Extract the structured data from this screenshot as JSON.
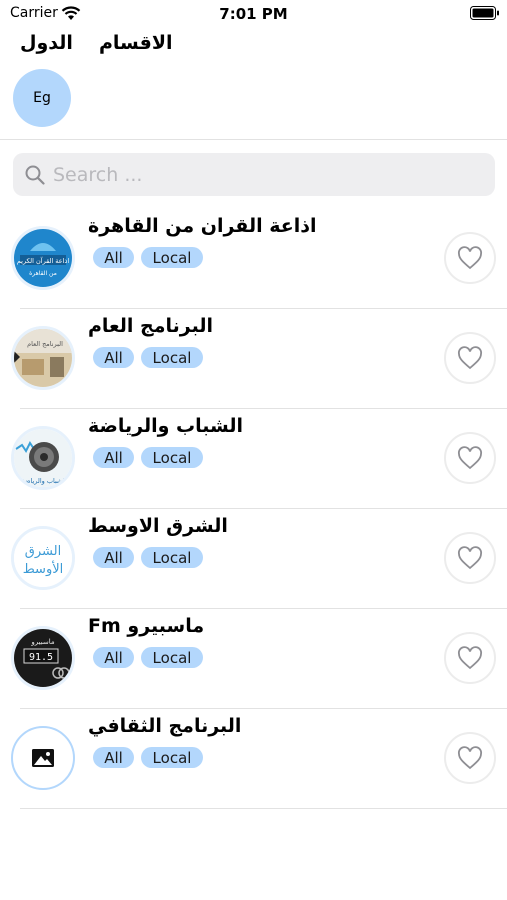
{
  "status_bar": {
    "carrier": "Carrier",
    "time": "7:01 PM"
  },
  "tabs": {
    "countries": "الدول",
    "categories": "الاقسام"
  },
  "country_chip": "Eg",
  "search": {
    "placeholder": "Search ..."
  },
  "stations": [
    {
      "name": "اذاعة القران من القاهرة",
      "tag_all": "All",
      "tag_local": "Local",
      "logo": "quran-cairo",
      "logo_text": [
        "اذاعة القرآن الكريم",
        "من القاهرة"
      ]
    },
    {
      "name": "البرنامج العام",
      "tag_all": "All",
      "tag_local": "Local",
      "logo": "general-program",
      "logo_text": [
        "البرنامج العام"
      ]
    },
    {
      "name": "الشباب والرياضة",
      "tag_all": "All",
      "tag_local": "Local",
      "logo": "youth-sports",
      "logo_text": [
        "الشباب والرياضة"
      ]
    },
    {
      "name": "الشرق الاوسط",
      "tag_all": "All",
      "tag_local": "Local",
      "logo": "middle-east",
      "logo_text": [
        "الشرق",
        "الأوسط"
      ]
    },
    {
      "name": "ماسبيرو Fm",
      "tag_all": "All",
      "tag_local": "Local",
      "logo": "maspero-fm",
      "logo_text": [
        "ماسبيرو",
        "91.5"
      ]
    },
    {
      "name": "البرنامج الثقافي",
      "tag_all": "All",
      "tag_local": "Local",
      "logo": "placeholder-image"
    }
  ],
  "colors": {
    "accent": "#b3d7fc",
    "search_bg": "#eeeef0",
    "divider": "#e2e2e2"
  }
}
